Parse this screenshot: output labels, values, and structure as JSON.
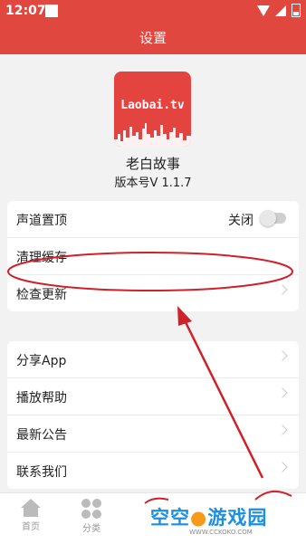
{
  "status_bar": {
    "time": "12:07"
  },
  "header": {
    "title": "设置"
  },
  "app": {
    "logo_text": "Laobai.tv",
    "name": "老白故事",
    "version": "版本号V 1.1.7"
  },
  "settings": {
    "group1": [
      {
        "label": "声道置顶",
        "toggle_label": "关闭",
        "toggle_on": false
      },
      {
        "label": "清理缓存"
      },
      {
        "label": "检查更新"
      }
    ],
    "group2": [
      {
        "label": "分享App"
      },
      {
        "label": "播放帮助"
      },
      {
        "label": "最新公告"
      },
      {
        "label": "联系我们"
      }
    ]
  },
  "bottom_nav": [
    {
      "label": "首页",
      "icon": "home-icon"
    },
    {
      "label": "分类",
      "icon": "grid-icon"
    }
  ],
  "watermark": {
    "text_a": "空空",
    "text_b": "游戏园",
    "sub": "WWW.CCKOKO.COM"
  },
  "colors": {
    "accent": "#e0473e",
    "annotation": "#d0202a",
    "watermark": "#1a8fe3"
  }
}
